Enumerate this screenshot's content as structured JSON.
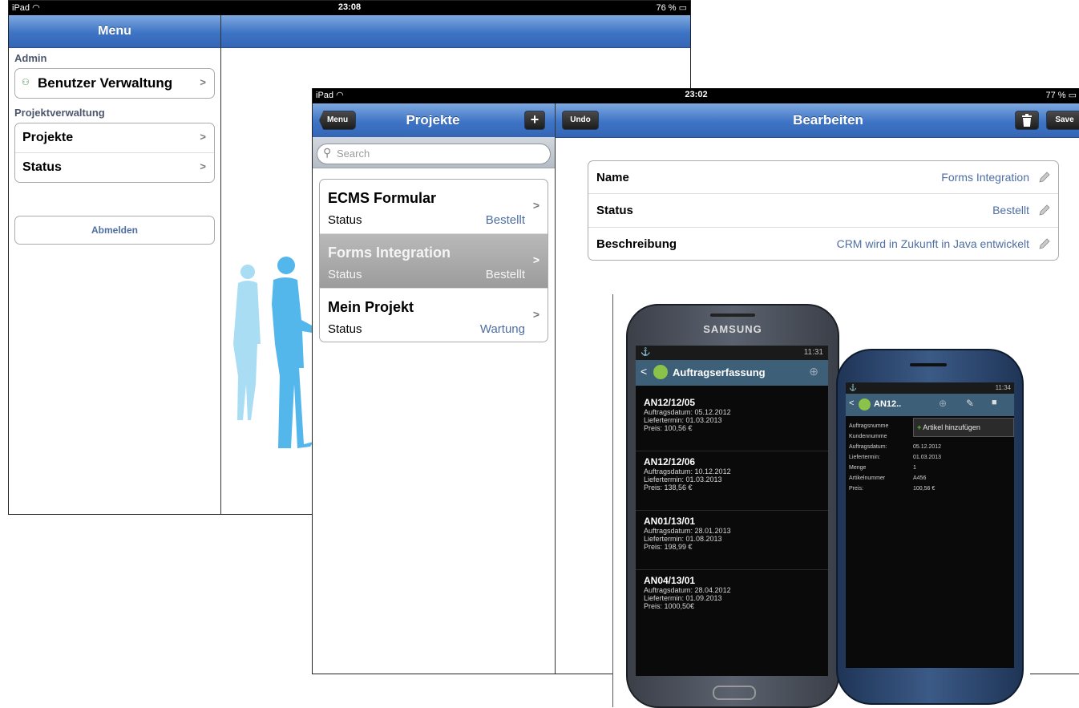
{
  "back_ipad": {
    "status": {
      "carrier": "iPad",
      "time": "23:08",
      "battery": "76 %"
    },
    "menu_title": "Menu",
    "sections": [
      {
        "header": "Admin",
        "items": [
          {
            "label": "Benutzer Verwaltung",
            "icon": "users-icon"
          }
        ]
      },
      {
        "header": "Projektverwaltung",
        "items": [
          {
            "label": "Projekte"
          },
          {
            "label": "Status"
          }
        ]
      }
    ],
    "logout_label": "Abmelden"
  },
  "front_ipad": {
    "status": {
      "carrier": "iPad",
      "time": "23:02",
      "battery": "77 %"
    },
    "master": {
      "menu_button": "Menu",
      "title": "Projekte",
      "add_button": "+",
      "search_placeholder": "Search",
      "projects": [
        {
          "name": "ECMS Formular",
          "status_label": "Status",
          "status_value": "Bestellt",
          "selected": false
        },
        {
          "name": "Forms Integration",
          "status_label": "Status",
          "status_value": "Bestellt",
          "selected": true
        },
        {
          "name": "Mein Projekt",
          "status_label": "Status",
          "status_value": "Wartung",
          "selected": false
        }
      ]
    },
    "detail": {
      "undo_button": "Undo",
      "title": "Bearbeiten",
      "save_button": "Save",
      "fields": [
        {
          "label": "Name",
          "value": "Forms Integration"
        },
        {
          "label": "Status",
          "value": "Bestellt"
        },
        {
          "label": "Beschreibung",
          "value": "CRM wird in Zukunft in Java entwickelt"
        }
      ]
    }
  },
  "phone_large": {
    "brand": "SAMSUNG",
    "clock": "11:31",
    "title": "Auftragserfassung",
    "orders": [
      {
        "id": "AN12/12/05",
        "lines": [
          "Auftragsdatum:  05.12.2012",
          "Liefertermin:  01.03.2013",
          "Preis:  100,56 €"
        ]
      },
      {
        "id": "AN12/12/06",
        "lines": [
          "Auftragsdatum:  10.12.2012",
          "Liefertermin:  01.03.2013",
          "Preis:  138,56 €"
        ]
      },
      {
        "id": "AN01/13/01",
        "lines": [
          "Auftragsdatum:  28.01.2013",
          "Liefertermin:  01.08.2013",
          "Preis:  198,99 €"
        ]
      },
      {
        "id": "AN04/13/01",
        "lines": [
          "Auftragsdatum:  28.04.2012",
          "Liefertermin:  01.09.2013",
          "Preis:  1000,50€"
        ]
      }
    ]
  },
  "phone_small": {
    "clock": "11:34",
    "title": "AN12..",
    "popup": "Artikel hinzufügen",
    "rows": [
      {
        "k": "Auftragsnumme",
        "v": ""
      },
      {
        "k": "Kundennumme",
        "v": ""
      },
      {
        "k": "Auftragsdatum:",
        "v": "05.12.2012"
      },
      {
        "k": "Liefertermin:",
        "v": "01.03.2013"
      },
      {
        "k": "Menge",
        "v": "1"
      },
      {
        "k": "Artikelnummer",
        "v": "A456"
      },
      {
        "k": "Preis:",
        "v": "100,56 €"
      }
    ]
  },
  "colors": {
    "nav_blue": "#3e74c5",
    "link_blue": "#4d6ea3",
    "selected_row": "#a8a8a8",
    "person_light": "#a9ddf4",
    "person_dark": "#53b7ec"
  }
}
